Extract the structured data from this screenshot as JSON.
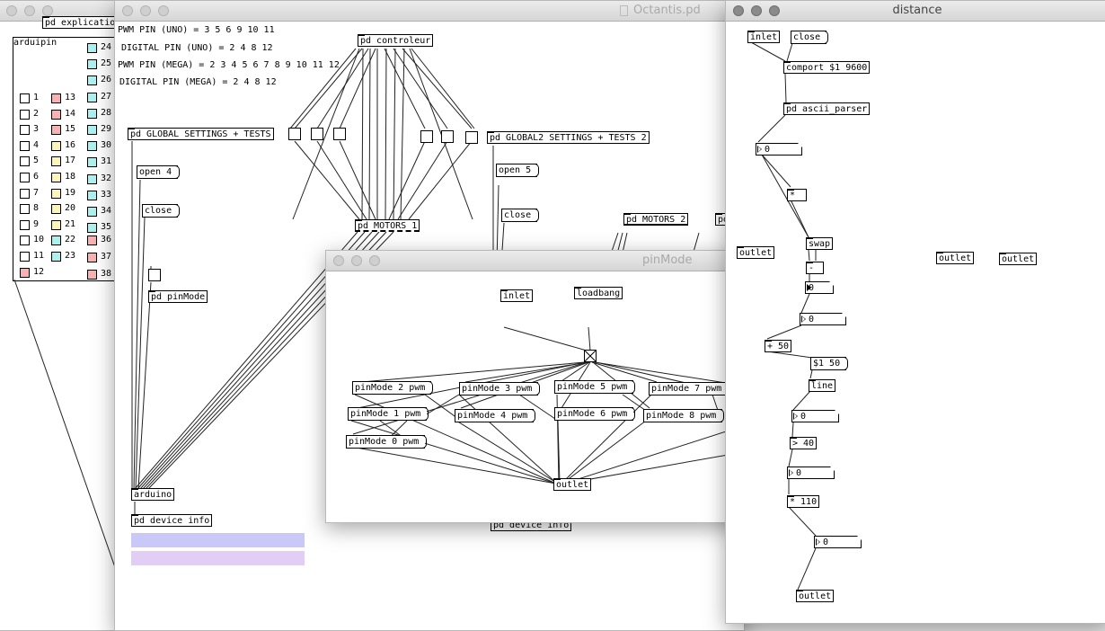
{
  "colors": {
    "toggle_white": "#ffffff",
    "toggle_pink": "#f7b3b3",
    "toggle_yellow": "#fbf5bd",
    "toggle_cyan": "#aef0ee",
    "bar_blue": "#c9c8f6",
    "bar_lilac": "#e2cdf4"
  },
  "explication_window": {
    "partial_label": "pd explication",
    "arduipin_label": "arduipin",
    "pins": [
      {
        "n": "1",
        "color": "white"
      },
      {
        "n": "2",
        "color": "white"
      },
      {
        "n": "3",
        "color": "white"
      },
      {
        "n": "4",
        "color": "white"
      },
      {
        "n": "5",
        "color": "white"
      },
      {
        "n": "6",
        "color": "white"
      },
      {
        "n": "7",
        "color": "white"
      },
      {
        "n": "8",
        "color": "white"
      },
      {
        "n": "9",
        "color": "white"
      },
      {
        "n": "10",
        "color": "white"
      },
      {
        "n": "11",
        "color": "white"
      },
      {
        "n": "12",
        "color": "pink"
      },
      {
        "n": "13",
        "color": "pink"
      },
      {
        "n": "14",
        "color": "pink"
      },
      {
        "n": "15",
        "color": "pink"
      },
      {
        "n": "16",
        "color": "yellow"
      },
      {
        "n": "17",
        "color": "yellow"
      },
      {
        "n": "18",
        "color": "yellow"
      },
      {
        "n": "19",
        "color": "yellow"
      },
      {
        "n": "20",
        "color": "yellow"
      },
      {
        "n": "21",
        "color": "yellow"
      },
      {
        "n": "22",
        "color": "cyan"
      },
      {
        "n": "23",
        "color": "cyan"
      },
      {
        "n": "24",
        "color": "cyan"
      },
      {
        "n": "25",
        "color": "cyan"
      },
      {
        "n": "26",
        "color": "cyan"
      },
      {
        "n": "27",
        "color": "cyan"
      },
      {
        "n": "28",
        "color": "cyan"
      },
      {
        "n": "29",
        "color": "cyan"
      },
      {
        "n": "30",
        "color": "cyan"
      },
      {
        "n": "31",
        "color": "cyan"
      },
      {
        "n": "32",
        "color": "cyan"
      },
      {
        "n": "33",
        "color": "cyan"
      },
      {
        "n": "34",
        "color": "cyan"
      },
      {
        "n": "35",
        "color": "cyan"
      },
      {
        "n": "36",
        "color": "pink"
      },
      {
        "n": "37",
        "color": "pink"
      },
      {
        "n": "38",
        "color": "pink"
      }
    ]
  },
  "octantis": {
    "title": "Octantis.pd",
    "comments": [
      "PWM PIN (UNO) = 3 5 6 9 10 11",
      "DIGITAL PIN (UNO) = 2 4 8 12",
      "PWM PIN (MEGA) = 2 3 4 5 6 7 8 9 10 11 12",
      "DIGITAL PIN (MEGA) = 2 4 8 12"
    ],
    "controleur": "pd controleur",
    "global_settings": "pd GLOBAL SETTINGS + TESTS",
    "global2_settings": "pd GLOBAL2 SETTINGS + TESTS 2",
    "open_4": "open 4",
    "close_1": "close",
    "open_5": "open 5",
    "close_2": "close",
    "motors_1": "pd MOTORS 1",
    "motors_2": "pd MOTORS 2",
    "motors_partial": "pd",
    "pinmode_sub": "pd pinMode",
    "arduino": "arduino",
    "device_info_1": "pd device info",
    "device_info_2": "pd device info"
  },
  "pinmode": {
    "title": "pinMode",
    "inlet": "inlet",
    "loadbang": "loadbang",
    "outlet": "outlet",
    "messages": [
      "pinMode 2 pwm",
      "pinMode 3 pwm",
      "pinMode 5 pwm",
      "pinMode 7 pwm",
      "pinMode 1 pwm",
      "pinMode 4 pwm",
      "pinMode 6 pwm",
      "pinMode 8 pwm",
      "pinMode 0 pwm"
    ]
  },
  "distance": {
    "title": "distance",
    "inlet": "inlet",
    "close": "close",
    "comport": "comport $1 9600",
    "ascii_parser": "pd ascii_parser",
    "num_zero": "0",
    "mul": "*",
    "swap": "swap",
    "minus": "-",
    "plus_50": "+ 50",
    "msg_50": "$1 50",
    "line": "line",
    "gt_40": "> 40",
    "mul_110": "* 110",
    "outlet": "outlet"
  }
}
